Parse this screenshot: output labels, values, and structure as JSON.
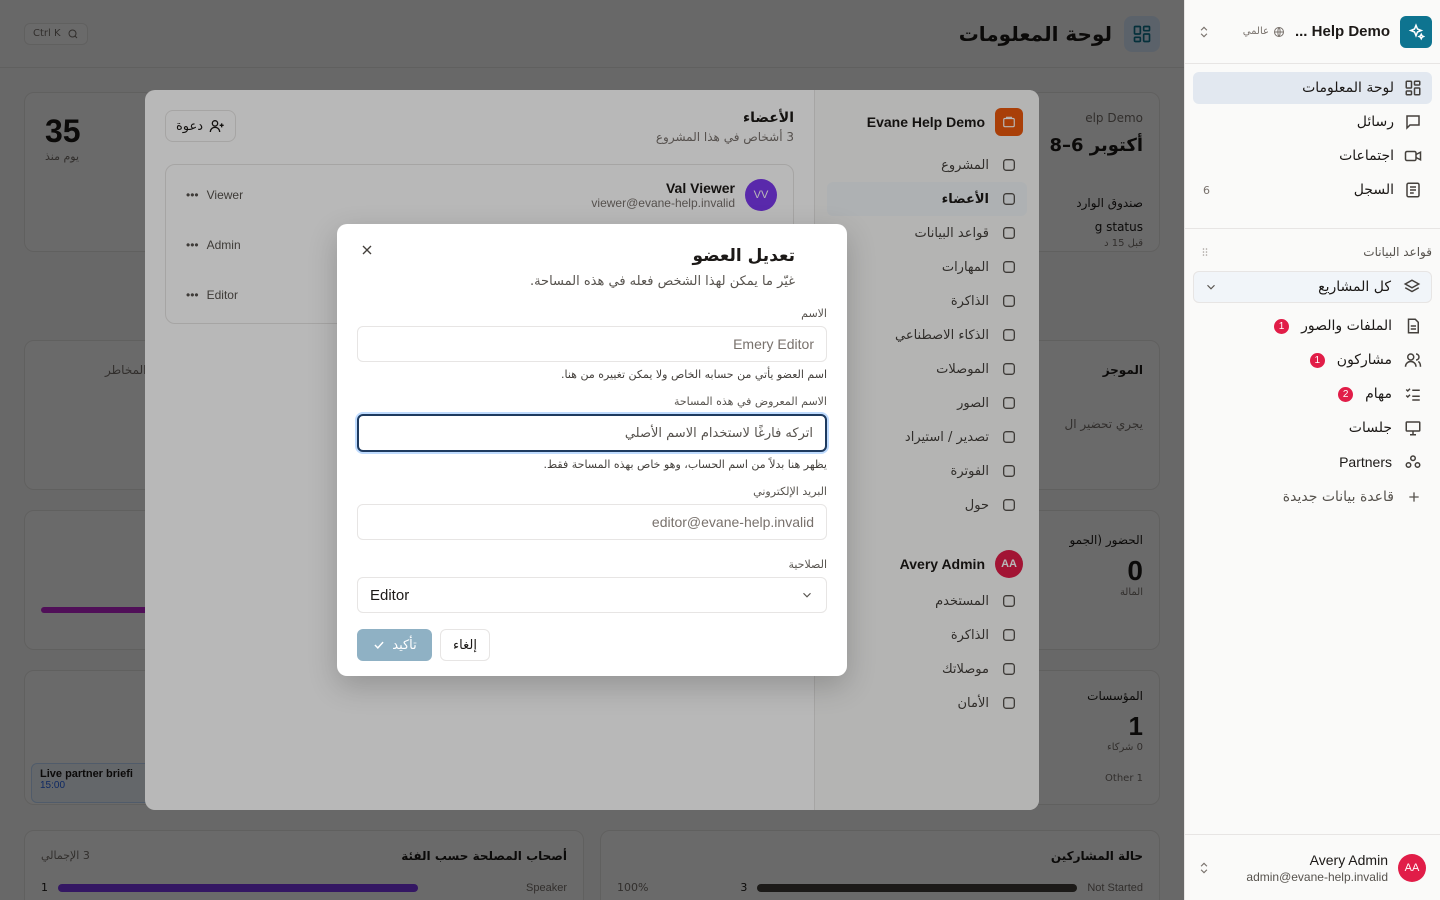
{
  "main": {
    "search_shortcut": "Ctrl K",
    "page_title": "لوحة المعلومات",
    "stat_days": "35",
    "stat_days_label": "يوم منذ",
    "card_date": "أكتوبر 6–8",
    "card_risks": "المخاطر",
    "card_summary": "الموجز",
    "card_prep": "يجري تحضير ال",
    "card_inbox": "صندوق الوارد",
    "card_status": "g status",
    "card_status_sub": "قبل 15 د",
    "card_attendance": "الحضور (الجمو",
    "attendance_value": "0",
    "attendance_label": "المالة",
    "card_orgs": "المؤسسات",
    "orgs_value": "1",
    "orgs_sub": "0 شركاء",
    "orgs_other": "1 Other",
    "live_brief": "Live partner briefi",
    "live_time": "15:00",
    "card_stakeholders": "أصحاب المصلحة حسب الفئة",
    "stakeholders_total": "3 الإجمالي",
    "stake_speaker": "Speaker",
    "stake_value": "1",
    "card_participants": "حالة المشاركين",
    "participants_pct": "100%",
    "participants_value": "3",
    "participants_status": "Not Started",
    "project_header_fragment": "elp Demo"
  },
  "sidebar": {
    "workspace_name": "Help Demo ...",
    "workspace_scope": "عالمي",
    "nav": [
      {
        "label": "لوحة المعلومات",
        "icon": "dashboard-icon"
      },
      {
        "label": "رسائل",
        "icon": "message-icon"
      },
      {
        "label": "اجتماعات",
        "icon": "video-icon"
      },
      {
        "label": "السجل",
        "icon": "log-icon",
        "count": "6"
      }
    ],
    "databases_heading": "قواعد البيانات",
    "all_projects": "كل المشاريع",
    "db_items": [
      {
        "label": "الملفات والصور",
        "badge": "1"
      },
      {
        "label": "مشاركون",
        "badge": "1"
      },
      {
        "label": "مهام",
        "badge": "2"
      },
      {
        "label": "جلسات",
        "badge": ""
      },
      {
        "label": "Partners",
        "badge": ""
      }
    ],
    "new_database": "قاعدة بيانات جديدة",
    "user": {
      "initials": "AA",
      "name": "Avery Admin",
      "email": "admin@evane-help.invalid"
    }
  },
  "settings": {
    "project_name": "Evane Help Demo",
    "project_items": [
      "المشروع",
      "الأعضاء",
      "قواعد البيانات",
      "المهارات",
      "الذاكرة",
      "الذكاء الاصطناعي",
      "الموصلات",
      "الصور",
      "تصدير / استيراد",
      "الفوترة",
      "حول"
    ],
    "user_name": "Avery Admin",
    "user_initials": "AA",
    "user_items": [
      "المستخدم",
      "الذاكرة",
      "موصلاتك",
      "الأمان"
    ],
    "members_title": "الأعضاء",
    "members_sub": "3 أشخاص في هذا المشروع",
    "invite_label": "دعوة",
    "members": [
      {
        "name": "Val Viewer",
        "email": "viewer@evane-help.invalid",
        "initials": "VV",
        "role": "Viewer"
      },
      {
        "name": "",
        "email": "",
        "initials": "",
        "role": "Admin"
      },
      {
        "name": "",
        "email": "",
        "initials": "",
        "role": "Editor"
      }
    ]
  },
  "modal": {
    "title": "تعديل العضو",
    "subtitle": "غيّر ما يمكن لهذا الشخص فعله في هذه المساحة.",
    "name_label": "الاسم",
    "name_value": "Emery Editor",
    "name_hint": "اسم العضو يأتي من حسابه الخاص ولا يمكن تغييره من هنا.",
    "display_label": "الاسم المعروض في هذه المساحة",
    "display_placeholder": "اتركه فارغًا لاستخدام الاسم الأصلي",
    "display_hint": "يظهر هنا بدلاً من اسم الحساب، وهو خاص بهذه المساحة فقط.",
    "email_label": "البريد الإلكتروني",
    "email_value": "editor@evane-help.invalid",
    "role_label": "الصلاحية",
    "role_value": "Editor",
    "confirm_label": "تأكيد",
    "cancel_label": "إلغاء"
  },
  "colors": {
    "brand": "#0e7490",
    "badge": "#e11d48",
    "confirm_disabled": "#8fb1c4",
    "focus_ring": "#1e3a5f"
  }
}
